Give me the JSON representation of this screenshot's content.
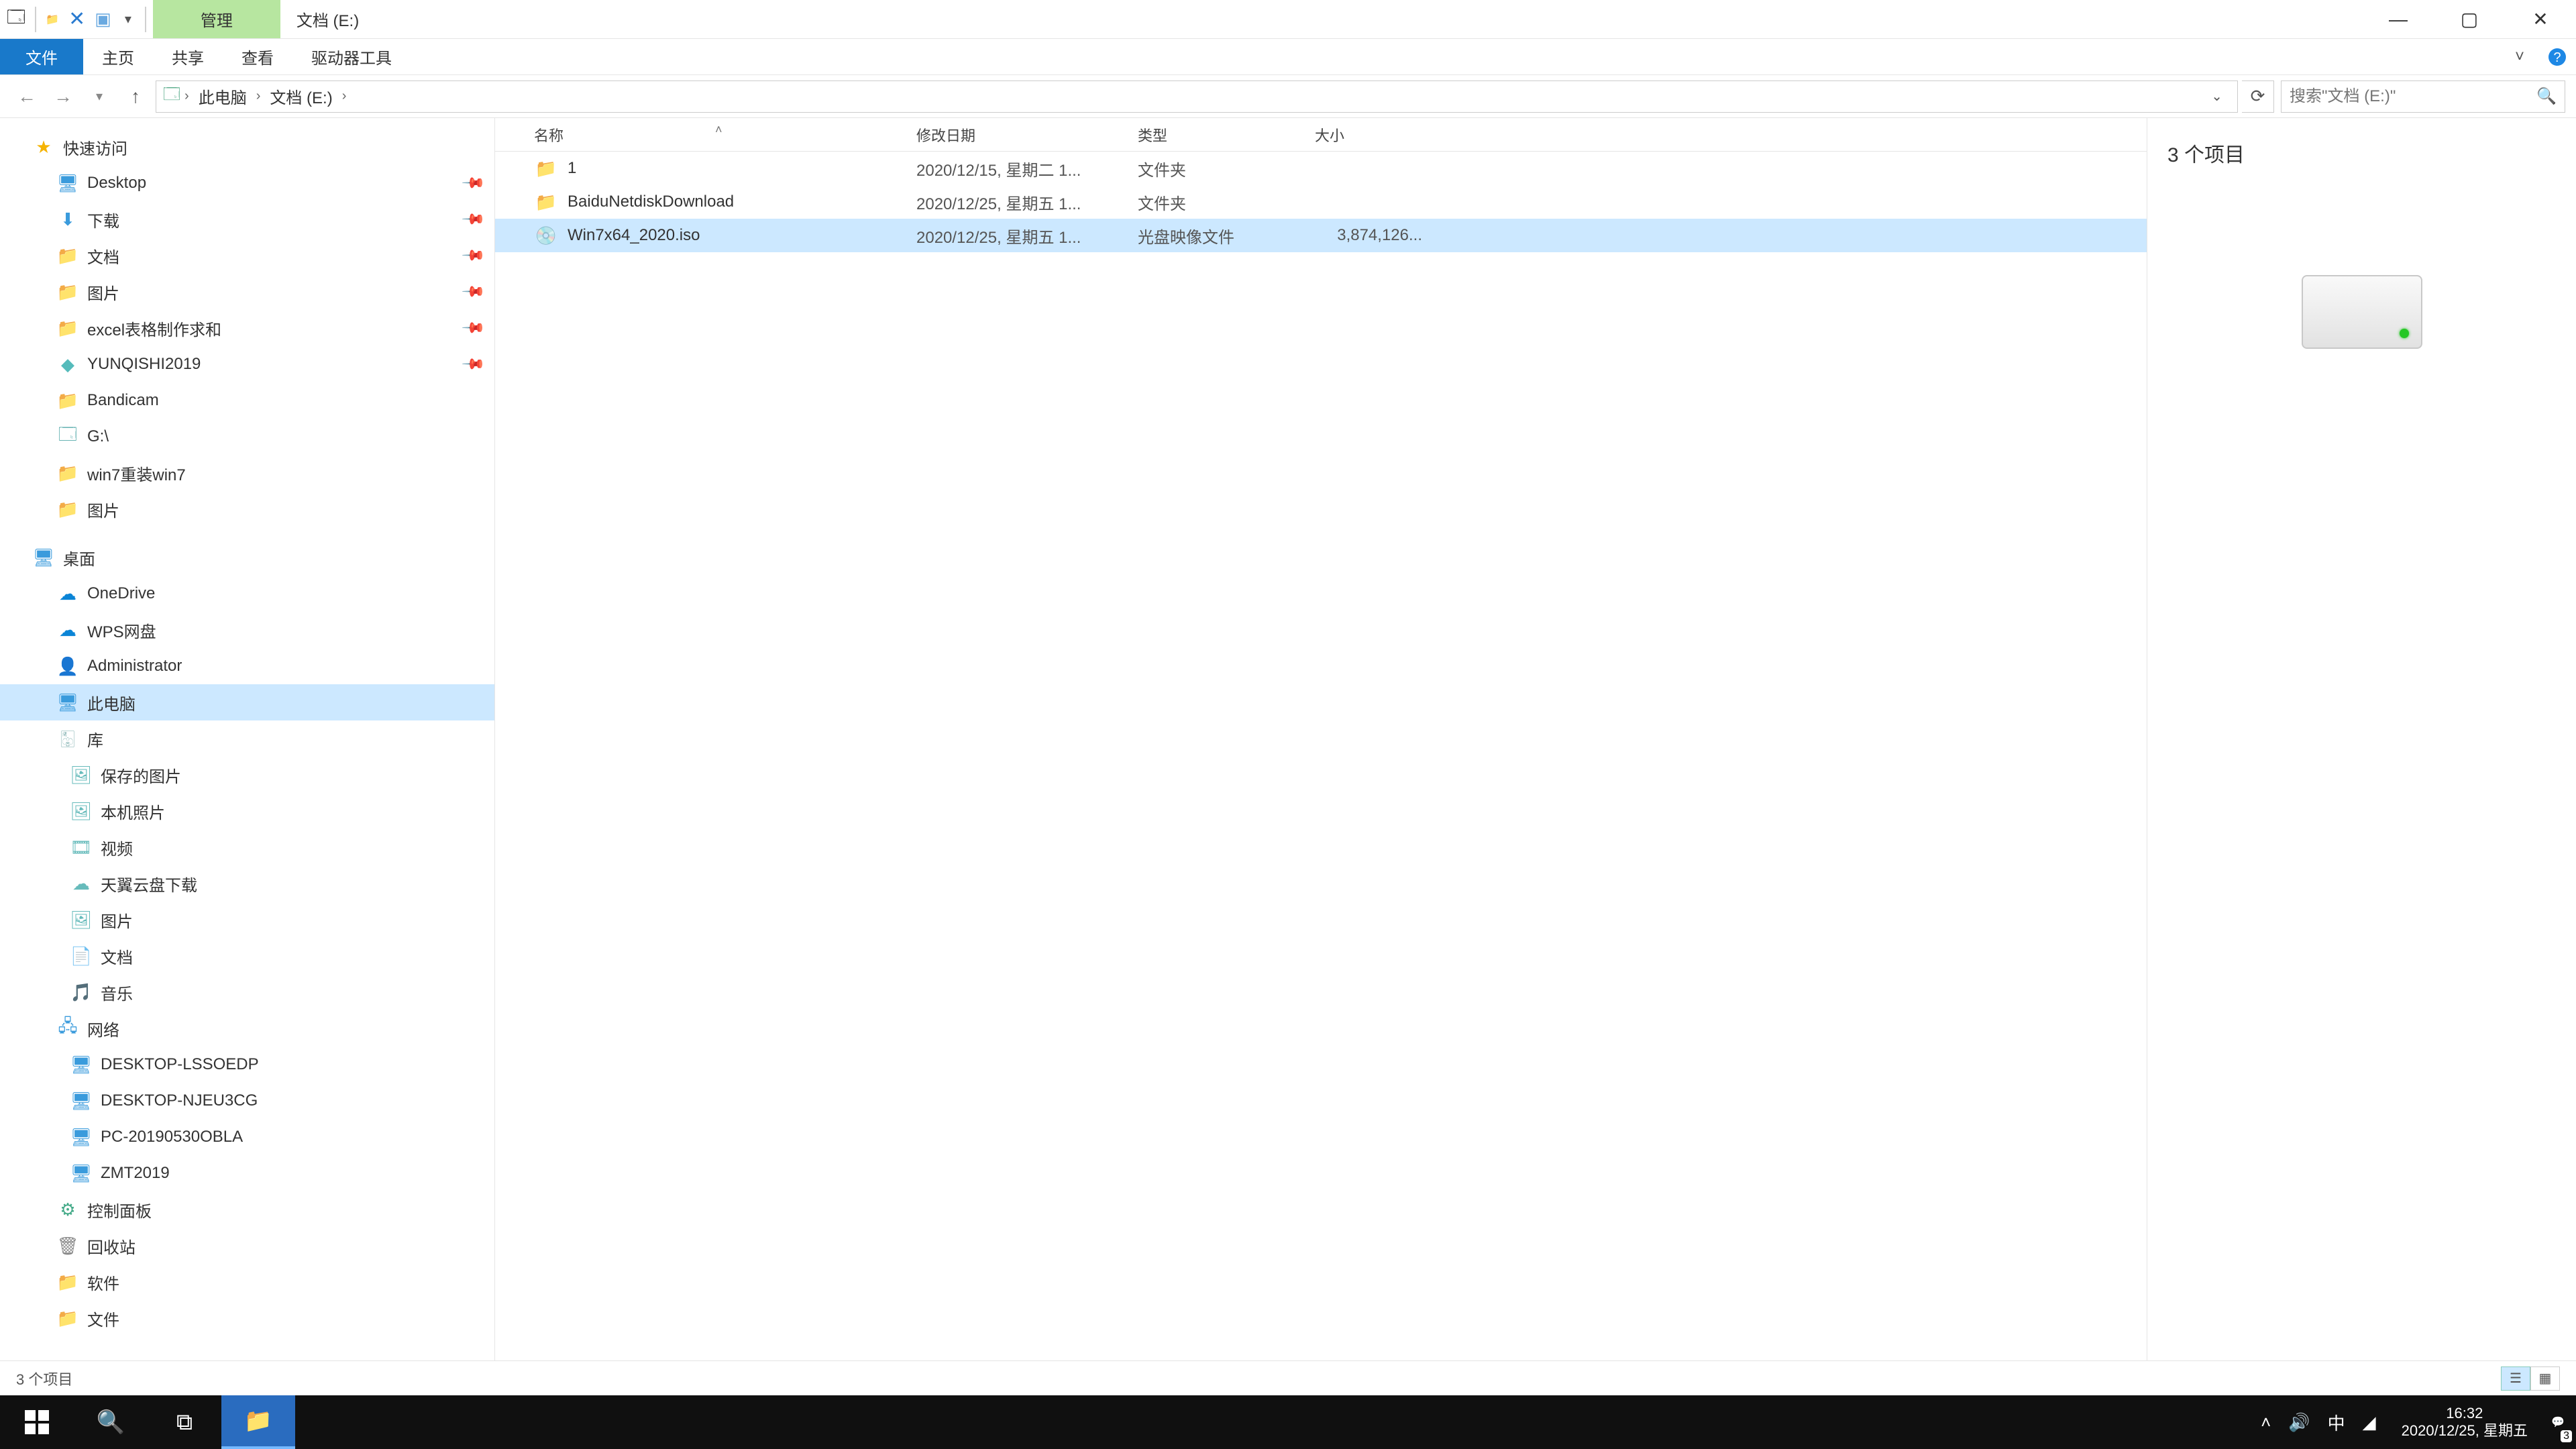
{
  "titlebar": {
    "ribbon_context": "管理",
    "window_title": "文档 (E:)"
  },
  "menu": {
    "file": "文件",
    "home": "主页",
    "share": "共享",
    "view": "查看",
    "drive_tools": "驱动器工具"
  },
  "address": {
    "crumb_root": "此电脑",
    "crumb_drive": "文档 (E:)",
    "search_placeholder": "搜索\"文档 (E:)\""
  },
  "nav": {
    "quick_access": "快速访问",
    "desktop": "Desktop",
    "downloads": "下载",
    "documents": "文档",
    "pictures": "图片",
    "excel": "excel表格制作求和",
    "yunqishi": "YUNQISHI2019",
    "bandicam": "Bandicam",
    "gdrive": "G:\\",
    "win7": "win7重装win7",
    "pictures2": "图片",
    "desktop_zh": "桌面",
    "onedrive": "OneDrive",
    "wps": "WPS网盘",
    "admin": "Administrator",
    "this_pc": "此电脑",
    "library": "库",
    "saved_pics": "保存的图片",
    "camera_roll": "本机照片",
    "videos": "视频",
    "tianyicloud": "天翼云盘下载",
    "pictures3": "图片",
    "documents2": "文档",
    "music": "音乐",
    "network": "网络",
    "pc1": "DESKTOP-LSSOEDP",
    "pc2": "DESKTOP-NJEU3CG",
    "pc3": "PC-20190530OBLA",
    "pc4": "ZMT2019",
    "control_panel": "控制面板",
    "recycle": "回收站",
    "software": "软件",
    "files": "文件"
  },
  "columns": {
    "name": "名称",
    "date": "修改日期",
    "type": "类型",
    "size": "大小"
  },
  "files": [
    {
      "name": "1",
      "date": "2020/12/15, 星期二 1...",
      "type": "文件夹",
      "size": "",
      "icon": "folder"
    },
    {
      "name": "BaiduNetdiskDownload",
      "date": "2020/12/25, 星期五 1...",
      "type": "文件夹",
      "size": "",
      "icon": "folder"
    },
    {
      "name": "Win7x64_2020.iso",
      "date": "2020/12/25, 星期五 1...",
      "type": "光盘映像文件",
      "size": "3,874,126...",
      "icon": "iso",
      "selected": true
    }
  ],
  "details_pane": {
    "count": "3 个项目"
  },
  "statusbar": {
    "count": "3 个项目"
  },
  "taskbar": {
    "time": "16:32",
    "date": "2020/12/25, 星期五",
    "ime": "中",
    "notif_count": "3"
  }
}
